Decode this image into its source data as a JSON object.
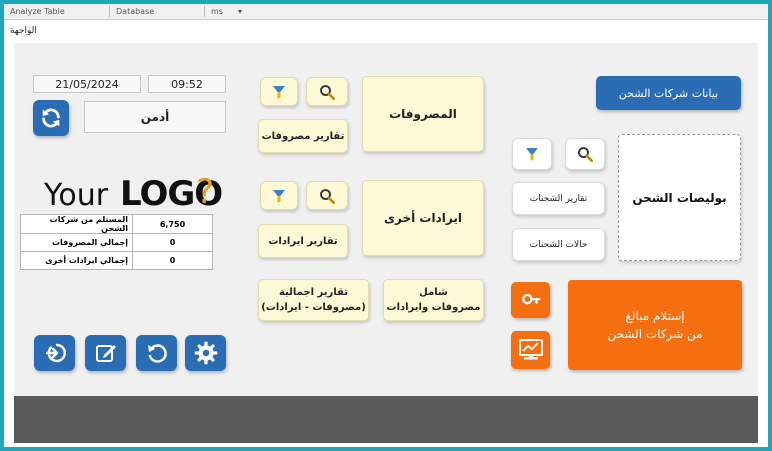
{
  "access_bar": {
    "object_label": "Analyze Table",
    "segment_two": "Database",
    "segment_three": "ms"
  },
  "form_tab": "الواجهة",
  "header": {
    "date": "21/05/2024",
    "time": "09:52",
    "user": "أدمن"
  },
  "logo": {
    "text_your": "Your",
    "text_logo": "LOGO",
    "text_q": "?"
  },
  "buttons": {
    "shipping_companies": "بيانات شركات الشحن",
    "expenses": "المصروفات",
    "expense_reports": "تقارير مصروفات",
    "other_income": "ايرادات أخرى",
    "income_reports": "تقارير ايرادات",
    "summary_line1": "تقارير اجمالية",
    "summary_line2": "(مصروفات - ايرادات)",
    "comprehensive_line1": "شامل",
    "comprehensive_line2": "مصروفات وايرادات",
    "shipping_policies": "بوليصات الشحن",
    "shipment_reports": "تقارير الشحنات",
    "shipment_status": "حالات الشحنات",
    "receive_line1": "إستلام مبالغ",
    "receive_line2": "من شركات الشحن"
  },
  "stats": [
    {
      "label": "المستلم من شركات الشحن",
      "value": "6,750"
    },
    {
      "label": "إجمالي المصروفات",
      "value": "0"
    },
    {
      "label": "إجمالي ايرادات أخرى",
      "value": "0"
    }
  ],
  "colors": {
    "frame": "#1fa9b8",
    "primary_blue": "#2b6db4",
    "orange": "#f56e0f",
    "note_yellow": "#fdf9d6",
    "bottom_bar": "#595959"
  },
  "icons": {
    "refresh": "refresh-icon",
    "search": "search-icon",
    "filter": "filter-icon",
    "key": "key-icon",
    "monitor_chart": "monitor-chart-icon",
    "logout": "logout-icon",
    "edit": "edit-icon",
    "reset": "reset-icon",
    "settings": "gear-icon"
  }
}
